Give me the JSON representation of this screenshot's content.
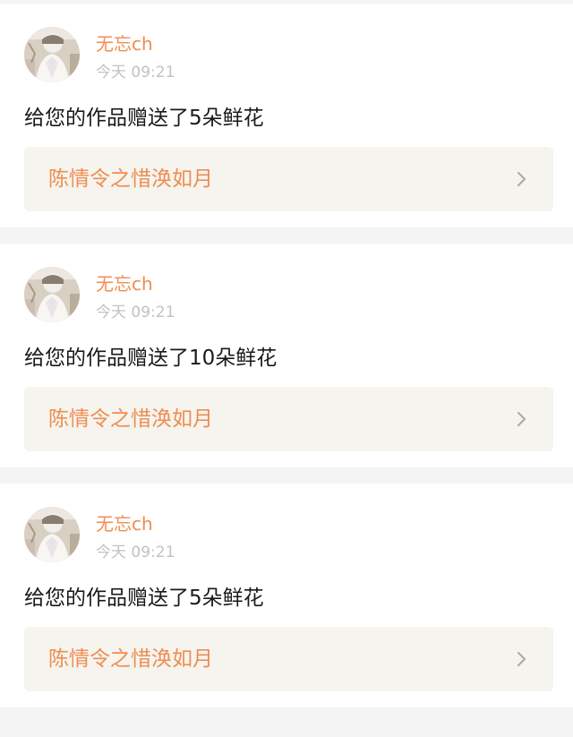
{
  "theme": {
    "accent": "#ef8d52",
    "muted": "#c2c2c2",
    "card_bg": "#f5f4ee",
    "chevron": "#a9a9a9"
  },
  "notifications": [
    {
      "username": "无忘ch",
      "time": "今天 09:21",
      "message": "给您的作品赠送了5朵鲜花",
      "work_title": "陈情令之惜涣如月",
      "chevron_icon": "chevron-right-icon"
    },
    {
      "username": "无忘ch",
      "time": "今天 09:21",
      "message": "给您的作品赠送了10朵鲜花",
      "work_title": "陈情令之惜涣如月",
      "chevron_icon": "chevron-right-icon"
    },
    {
      "username": "无忘ch",
      "time": "今天 09:21",
      "message": "给您的作品赠送了5朵鲜花",
      "work_title": "陈情令之惜涣如月",
      "chevron_icon": "chevron-right-icon"
    }
  ]
}
